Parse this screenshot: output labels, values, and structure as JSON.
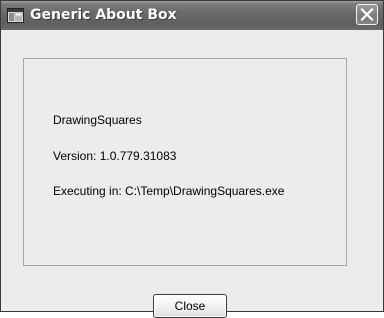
{
  "window": {
    "title": "Generic About Box",
    "title_icon": "application-window-icon",
    "close_icon": "close-icon"
  },
  "about": {
    "product_name": "DrawingSquares",
    "version_line": "Version: 1.0.779.31083",
    "executing_line": "Executing in: C:\\Temp\\DrawingSquares.exe"
  },
  "buttons": {
    "close_label": "Close"
  },
  "colors": {
    "titlebar": "#666666",
    "title_text": "#ffffff",
    "dialog_face": "#ececec",
    "group_border": "#a7a7a7"
  }
}
